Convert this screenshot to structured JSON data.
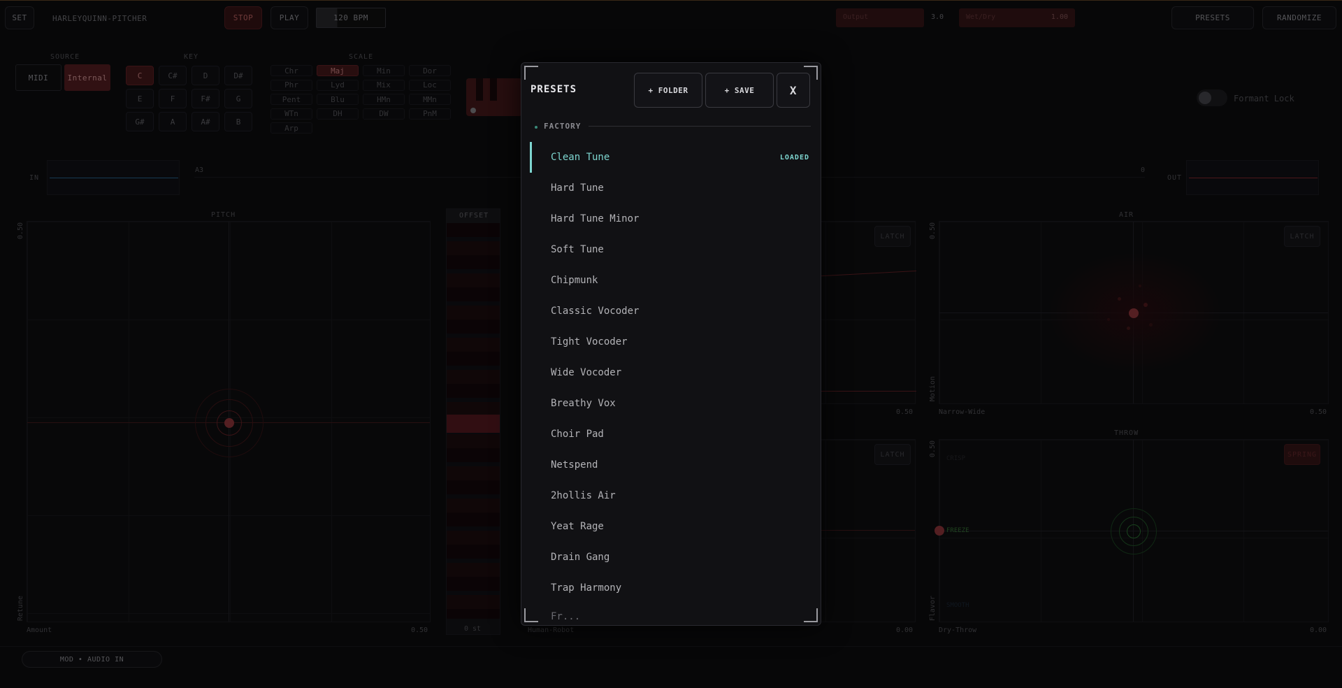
{
  "header": {
    "set_label": "SET",
    "app_name": "HARLEYQUINN-PITCHER",
    "stop_label": "STOP",
    "play_label": "PLAY",
    "bpm": "120 BPM",
    "output_label": "Output",
    "output_value": "3.0",
    "wetdry_label": "Wet/Dry",
    "wetdry_value": "1.00",
    "presets_label": "PRESETS",
    "randomize_label": "RANDOMIZE"
  },
  "source": {
    "label": "SOURCE",
    "midi": "MIDI",
    "internal": "Internal"
  },
  "key": {
    "label": "KEY",
    "notes": [
      "C",
      "C#",
      "D",
      "D#",
      "E",
      "F",
      "F#",
      "G",
      "G#",
      "A",
      "A#",
      "B"
    ],
    "selected": "C"
  },
  "scale": {
    "label": "SCALE",
    "options": [
      "Chr",
      "Maj",
      "Min",
      "Dor",
      "Phr",
      "Lyd",
      "Mix",
      "Loc",
      "Pent",
      "Blu",
      "HMn",
      "MMn",
      "WTn",
      "DH",
      "DW",
      "PnM",
      "Arp"
    ],
    "selected": "Maj"
  },
  "formant": {
    "label": "Formant Lock"
  },
  "meters": {
    "in_label": "IN",
    "out_label": "OUT",
    "mid_left": "A3",
    "mid_right": "0"
  },
  "pitch_pad": {
    "title": "PITCH",
    "y_top": "0.50",
    "y_label": "Retune",
    "x_label": "Amount",
    "x_max": "0.50"
  },
  "offset": {
    "title": "OFFSET",
    "value": "0 st"
  },
  "morph_pad": {
    "x_label": "Human-Robot",
    "x_max": "0.00",
    "y_max": "0.50",
    "latch_top": "LATCH",
    "latch_bottom": "LATCH"
  },
  "air_pad": {
    "title": "AIR",
    "y_top": "0.50",
    "y_label": "Motion",
    "x_label": "Narrow-Wide",
    "x_max": "0.50",
    "latch": "LATCH"
  },
  "throw_pad": {
    "title": "THROW",
    "y_top": "0.50",
    "y_label": "Flavor",
    "x_label": "Dry-Throw",
    "x_max": "0.00",
    "spring": "SPRING",
    "freeze": "FREEZE",
    "top_tag": "CRISP",
    "bottom_tag": "SMOOTH"
  },
  "footer": {
    "mod_label": "MOD • AUDIO IN"
  },
  "modal": {
    "title": "PRESETS",
    "folder_label": "+ FOLDER",
    "save_label": "+ SAVE",
    "close_label": "X",
    "section": "FACTORY",
    "loaded_tag": "LOADED",
    "presets": [
      "Clean Tune",
      "Hard Tune",
      "Hard Tune Minor",
      "Soft Tune",
      "Chipmunk",
      "Classic Vocoder",
      "Tight Vocoder",
      "Wide Vocoder",
      "Breathy Vox",
      "Choir Pad",
      "Netspend",
      "2hollis Air",
      "Yeat Rage",
      "Drain Gang",
      "Trap Harmony"
    ],
    "active": "Clean Tune"
  },
  "colors": {
    "accent_red": "#c0393f",
    "accent_teal": "#7ed6d0",
    "bg": "#0d0d0f"
  }
}
